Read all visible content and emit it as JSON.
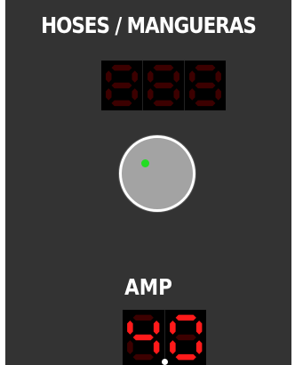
{
  "hoses": {
    "title": "HOSES / MANGUERAS",
    "display_text": "888",
    "display_state": "all segments unlit"
  },
  "knob": {
    "icon": "rotary-knob",
    "indicator_color": "#22dd22"
  },
  "amp": {
    "label": "AMP",
    "display_text": "4.0"
  },
  "colors": {
    "panel_background": "#333333",
    "segment_on": "#ff1a1a",
    "segment_off": "#3c0000",
    "display_background": "#000000"
  }
}
